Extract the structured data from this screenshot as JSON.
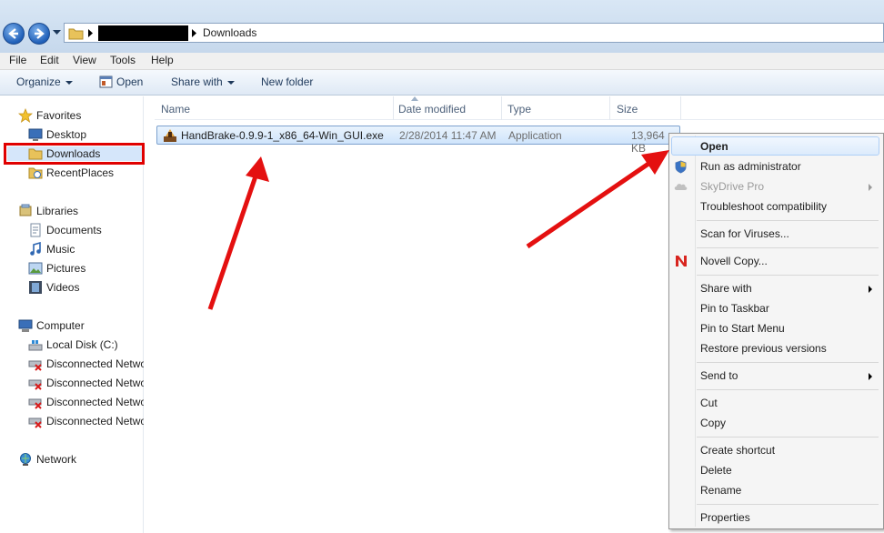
{
  "address": {
    "crumb": "Downloads"
  },
  "menu": [
    "File",
    "Edit",
    "View",
    "Tools",
    "Help"
  ],
  "toolbar": {
    "organize": "Organize",
    "open": "Open",
    "share_with": "Share with",
    "new_folder": "New folder"
  },
  "nav": {
    "favorites": "Favorites",
    "desktop": "Desktop",
    "downloads": "Downloads",
    "recent": "RecentPlaces",
    "libraries": "Libraries",
    "documents": "Documents",
    "music": "Music",
    "pictures": "Pictures",
    "videos": "Videos",
    "computer": "Computer",
    "local_disk": "Local Disk (C:)",
    "net_drive": "Disconnected Network Drive",
    "network": "Network"
  },
  "columns": {
    "name": "Name",
    "date": "Date modified",
    "type": "Type",
    "size": "Size"
  },
  "file": {
    "name": "HandBrake-0.9.9-1_x86_64-Win_GUI.exe",
    "date": "2/28/2014 11:47 AM",
    "type": "Application",
    "size": "13,964 KB"
  },
  "context_menu": {
    "open": "Open",
    "run_admin": "Run as administrator",
    "skydrive": "SkyDrive Pro",
    "troubleshoot": "Troubleshoot compatibility",
    "scan": "Scan for Viruses...",
    "novell": "Novell Copy...",
    "share_with": "Share with",
    "pin_taskbar": "Pin to Taskbar",
    "pin_start": "Pin to Start Menu",
    "restore": "Restore previous versions",
    "send_to": "Send to",
    "cut": "Cut",
    "copy": "Copy",
    "create_shortcut": "Create shortcut",
    "delete": "Delete",
    "rename": "Rename",
    "properties": "Properties"
  },
  "colors": {
    "highlight": "#e00000",
    "arrow": "#e41010",
    "selection": "#cfe4fb"
  }
}
